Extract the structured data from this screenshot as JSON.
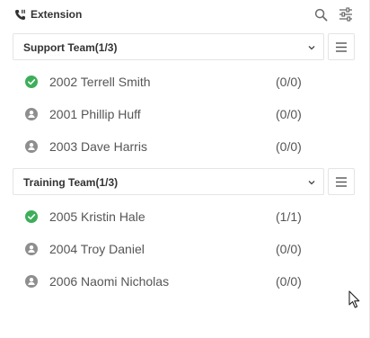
{
  "header": {
    "title": "Extension",
    "icon": "phone-extension-icon",
    "actions": [
      "search-icon",
      "filter-sliders-icon"
    ]
  },
  "colors": {
    "online": "#3dae5a",
    "offline": "#8e8e8e",
    "border": "#e4e4e4"
  },
  "groups": [
    {
      "label": "Support Team(1/3)",
      "members": [
        {
          "name": "2002 Terrell Smith",
          "count": "(0/0)",
          "status": "online"
        },
        {
          "name": "2001 Phillip Huff",
          "count": "(0/0)",
          "status": "offline"
        },
        {
          "name": "2003 Dave Harris",
          "count": "(0/0)",
          "status": "offline"
        }
      ]
    },
    {
      "label": "Training Team(1/3)",
      "members": [
        {
          "name": "2005 Kristin Hale",
          "count": "(1/1)",
          "status": "online"
        },
        {
          "name": "2004 Troy Daniel",
          "count": "(0/0)",
          "status": "offline"
        },
        {
          "name": "2006 Naomi Nicholas",
          "count": "(0/0)",
          "status": "offline"
        }
      ]
    }
  ]
}
